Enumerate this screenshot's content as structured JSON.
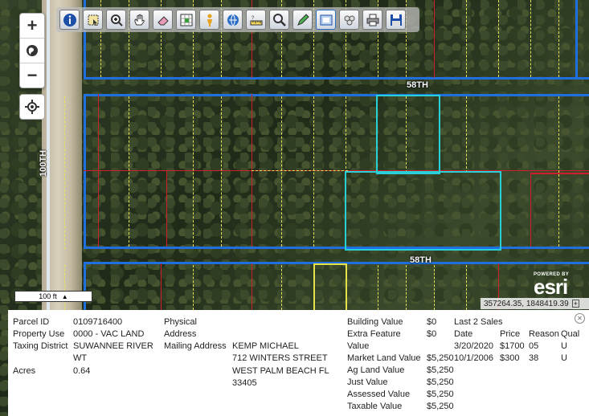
{
  "map": {
    "street_58th_top": "58TH",
    "street_58th_bottom": "58TH",
    "street_100th": "100TH",
    "scale_label": "100 ft",
    "powered_by": "POWERED BY",
    "esri_logo": "esri",
    "coordinates": "357264.35, 1848419.39"
  },
  "toolbar": {
    "tools": [
      "info-icon",
      "select-icon",
      "zoom-in-icon",
      "pan-icon",
      "eraser-icon",
      "grid-select-icon",
      "person-icon",
      "globe-icon",
      "measure-icon",
      "search-icon",
      "pencil-icon",
      "print-preview-icon",
      "layers-icon",
      "printer-icon",
      "save-icon"
    ]
  },
  "zoom": {
    "plus": "+",
    "minus": "−"
  },
  "parcel": {
    "labels": {
      "parcel_id": "Parcel ID",
      "property_use": "Property Use",
      "taxing_district": "Taxing District",
      "acres": "Acres",
      "physical": "Physical",
      "address": "Address",
      "mailing_address": "Mailing Address"
    },
    "values": {
      "parcel_id": "0109716400",
      "property_use": "0000 - VAC LAND",
      "taxing_district_1": "SUWANNEE RIVER",
      "taxing_district_2": "WT",
      "acres": "0.64",
      "mail_1": "KEMP MICHAEL",
      "mail_2": "712 WINTERS STREET",
      "mail_3": "WEST PALM BEACH FL",
      "mail_4": "33405"
    },
    "valuation": [
      {
        "label": "Building Value",
        "value": "$0"
      },
      {
        "label": "Extra Feature",
        "value": "$0"
      },
      {
        "label": "Value",
        "value": ""
      },
      {
        "label": "Market Land Value",
        "value": "$5,250"
      },
      {
        "label": "Ag Land Value",
        "value": "$5,250"
      },
      {
        "label": "Just Value",
        "value": "$5,250"
      },
      {
        "label": "Assessed Value",
        "value": "$5,250"
      },
      {
        "label": "Taxable Value",
        "value": "$5,250"
      }
    ],
    "sales": {
      "title": "Last 2 Sales",
      "headers": [
        "Date",
        "Price",
        "Reason",
        "Qual"
      ],
      "rows": [
        [
          "3/20/2020",
          "$1700",
          "05",
          "U"
        ],
        [
          "10/1/2006",
          "$300",
          "38",
          "U"
        ]
      ]
    }
  }
}
